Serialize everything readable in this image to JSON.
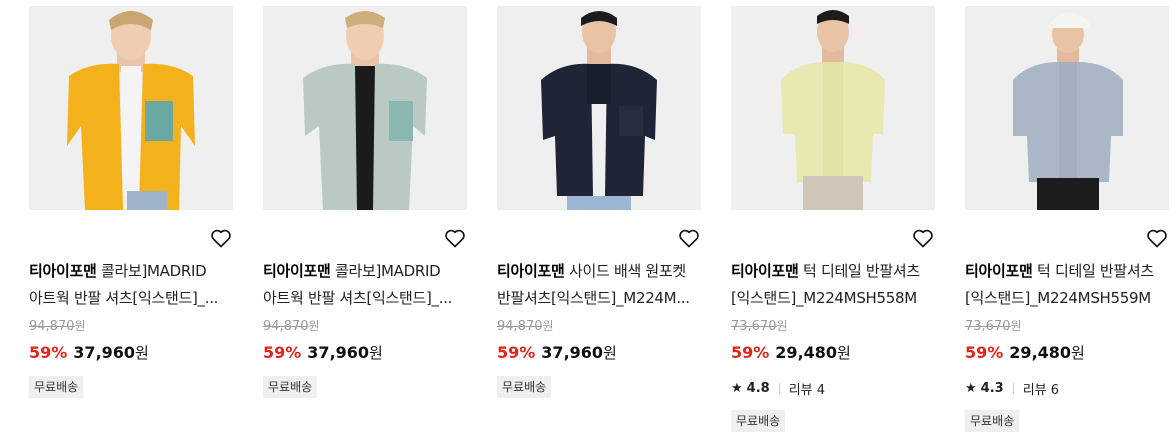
{
  "products": [
    {
      "brand": "티아이포맨",
      "title_line1": "콜라보]MADRID",
      "title_line2": "아트웍 반팔 셔츠[익스탠드]_...",
      "original_price": "94,870",
      "original_unit": "원",
      "discount": "59%",
      "price": "37,960",
      "price_unit": "원",
      "badge": "무료배송",
      "shirt_color": "#f3b21c",
      "wishlist_icon": "heart-icon"
    },
    {
      "brand": "티아이포맨",
      "title_line1": "콜라보]MADRID",
      "title_line2": "아트웍 반팔 셔츠[익스탠드]_...",
      "original_price": "94,870",
      "original_unit": "원",
      "discount": "59%",
      "price": "37,960",
      "price_unit": "원",
      "badge": "무료배송",
      "shirt_color": "#b9c9c4",
      "wishlist_icon": "heart-icon"
    },
    {
      "brand": "티아이포맨",
      "title_line1": "사이드 배색 원포켓",
      "title_line2": "반팔셔츠[익스탠드]_M224M...",
      "original_price": "94,870",
      "original_unit": "원",
      "discount": "59%",
      "price": "37,960",
      "price_unit": "원",
      "badge": "무료배송",
      "shirt_color": "#1f2536",
      "wishlist_icon": "heart-icon"
    },
    {
      "brand": "티아이포맨",
      "title_line1": "턱 디테일 반팔셔츠",
      "title_line2": "[익스탠드]_M224MSH558M",
      "original_price": "73,670",
      "original_unit": "원",
      "discount": "59%",
      "price": "29,480",
      "price_unit": "원",
      "rating": "4.8",
      "review": "리뷰 4",
      "badge": "무료배송",
      "shirt_color": "#e8e8b0",
      "wishlist_icon": "heart-icon"
    },
    {
      "brand": "티아이포맨",
      "title_line1": "턱 디테일 반팔셔츠",
      "title_line2": "[익스탠드]_M224MSH559M",
      "original_price": "73,670",
      "original_unit": "원",
      "discount": "59%",
      "price": "29,480",
      "price_unit": "원",
      "rating": "4.3",
      "review": "리뷰 6",
      "badge": "무료배송",
      "shirt_color": "#a9b7c6",
      "wishlist_icon": "heart-icon"
    }
  ],
  "colors": {
    "discount": "#e2241b",
    "badge_bg": "#efefef",
    "image_bg": "#efefef"
  }
}
